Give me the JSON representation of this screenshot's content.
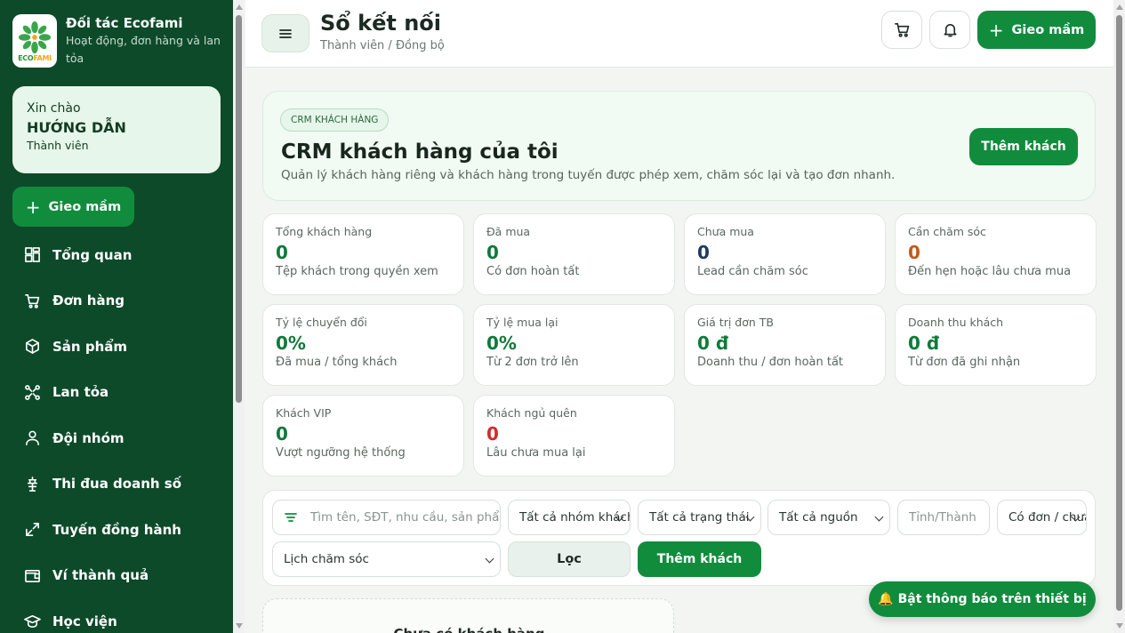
{
  "brand": {
    "name": "Đối tác Ecofami",
    "subtitle": "Hoạt động, đơn hàng và lan tỏa",
    "logo_text_a": "ECO",
    "logo_text_b": "FAMI"
  },
  "greeting": {
    "hello": "Xin chào",
    "name": "HƯỚNG DẪN",
    "role": "Thành viên"
  },
  "sidebar": {
    "seed_label": "Gieo mầm",
    "items": [
      {
        "label": "Tổng quan",
        "icon": "dashboard-icon"
      },
      {
        "label": "Đơn hàng",
        "icon": "cart-icon"
      },
      {
        "label": "Sản phẩm",
        "icon": "box-icon"
      },
      {
        "label": "Lan tỏa",
        "icon": "share-icon"
      },
      {
        "label": "Đội nhóm",
        "icon": "user-icon"
      },
      {
        "label": "Thi đua doanh số",
        "icon": "trophy-icon"
      },
      {
        "label": "Tuyến đồng hành",
        "icon": "route-icon"
      },
      {
        "label": "Ví thành quả",
        "icon": "wallet-icon"
      },
      {
        "label": "Học viện",
        "icon": "graduation-icon"
      }
    ]
  },
  "header": {
    "title": "Sổ kết nối",
    "breadcrumb": "Thành viên / Đồng bộ",
    "seed_label": "Gieo mầm"
  },
  "hero": {
    "pill": "CRM KHÁCH HÀNG",
    "title": "CRM khách hàng của tôi",
    "description": "Quản lý khách hàng riêng và khách hàng trong tuyến được phép xem, chăm sóc lại và tạo đơn nhanh.",
    "button": "Thêm khách"
  },
  "stats": [
    {
      "label": "Tổng khách hàng",
      "value": "0",
      "sub": "Tệp khách trong quyền xem",
      "color": "#0f7a3a"
    },
    {
      "label": "Đã mua",
      "value": "0",
      "sub": "Có đơn hoàn tất",
      "color": "#0f7a3a"
    },
    {
      "label": "Chưa mua",
      "value": "0",
      "sub": "Lead cần chăm sóc",
      "color": "#203a5c"
    },
    {
      "label": "Cần chăm sóc",
      "value": "0",
      "sub": "Đến hẹn hoặc lâu chưa mua",
      "color": "#c45a1a"
    },
    {
      "label": "Tỷ lệ chuyển đổi",
      "value": "0%",
      "sub": "Đã mua / tổng khách",
      "color": "#0f7a3a"
    },
    {
      "label": "Tỷ lệ mua lại",
      "value": "0%",
      "sub": "Từ 2 đơn trở lên",
      "color": "#0f7a3a"
    },
    {
      "label": "Giá trị đơn TB",
      "value": "0 đ",
      "sub": "Doanh thu / đơn hoàn tất",
      "color": "#0f7a3a"
    },
    {
      "label": "Doanh thu khách",
      "value": "0 đ",
      "sub": "Từ đơn đã ghi nhận",
      "color": "#0f7a3a"
    },
    {
      "label": "Khách VIP",
      "value": "0",
      "sub": "Vượt ngưỡng hệ thống",
      "color": "#0f7a3a"
    },
    {
      "label": "Khách ngủ quên",
      "value": "0",
      "sub": "Lâu chưa mua lại",
      "color": "#d22b2b"
    }
  ],
  "filters": {
    "search_placeholder": "Tìm tên, SĐT, nhu cầu, sản phẩm",
    "group": "Tất cả nhóm khách",
    "status": "Tất cả trạng thái",
    "source": "Tất cả nguồn",
    "province_placeholder": "Tỉnh/Thành",
    "orders": "Có đơn / chưa đơn",
    "schedule": "Lịch chăm sóc",
    "filter_button": "Lọc",
    "add_button": "Thêm khách"
  },
  "empty": {
    "title": "Chưa có khách hàng"
  },
  "notify": {
    "label": "🔔 Bật thông báo trên thiết bị"
  }
}
